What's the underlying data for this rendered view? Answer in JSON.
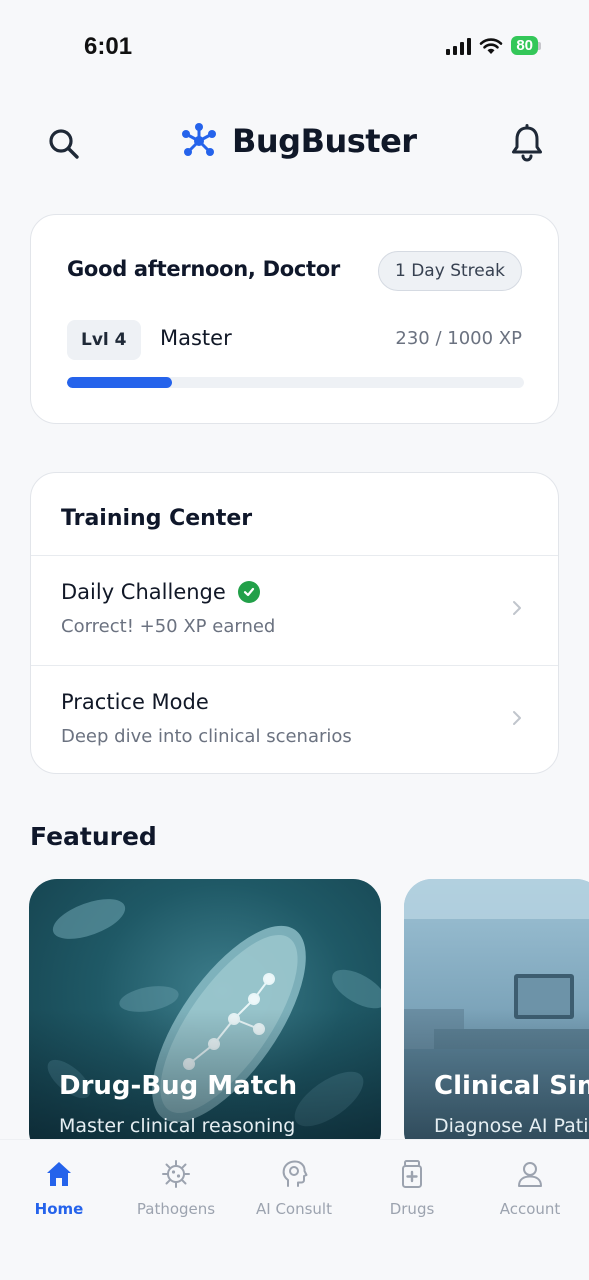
{
  "status_bar": {
    "time": "6:01",
    "battery": "80"
  },
  "header": {
    "title": "BugBuster",
    "icons": [
      "search-icon",
      "molecule-logo-icon",
      "bell-icon"
    ]
  },
  "greeting_card": {
    "greeting": "Good afternoon, Doctor",
    "streak": "1 Day Streak",
    "level_badge": "Lvl 4",
    "level_name": "Master",
    "xp": "230 / 1000 XP",
    "xp_progress_fraction": 0.23
  },
  "training_center": {
    "title": "Training Center",
    "items": [
      {
        "title": "Daily Challenge",
        "subtitle": "Correct! +50 XP earned",
        "completed": true
      },
      {
        "title": "Practice Mode",
        "subtitle": "Deep dive into clinical scenarios",
        "completed": false
      }
    ]
  },
  "featured": {
    "title": "Featured",
    "cards": [
      {
        "title": "Drug-Bug Match",
        "subtitle": "Master clinical reasoning"
      },
      {
        "title": "Clinical Sim",
        "subtitle": "Diagnose AI Patie"
      }
    ]
  },
  "bottom_nav": {
    "items": [
      {
        "label": "Home",
        "icon": "home-icon",
        "active": true
      },
      {
        "label": "Pathogens",
        "icon": "virus-icon",
        "active": false
      },
      {
        "label": "AI Consult",
        "icon": "brain-head-icon",
        "active": false
      },
      {
        "label": "Drugs",
        "icon": "medicine-bottle-icon",
        "active": false
      },
      {
        "label": "Account",
        "icon": "user-icon",
        "active": false
      }
    ]
  },
  "colors": {
    "accent": "#2563eb",
    "success": "#22a049",
    "background": "#f7f8fa"
  }
}
